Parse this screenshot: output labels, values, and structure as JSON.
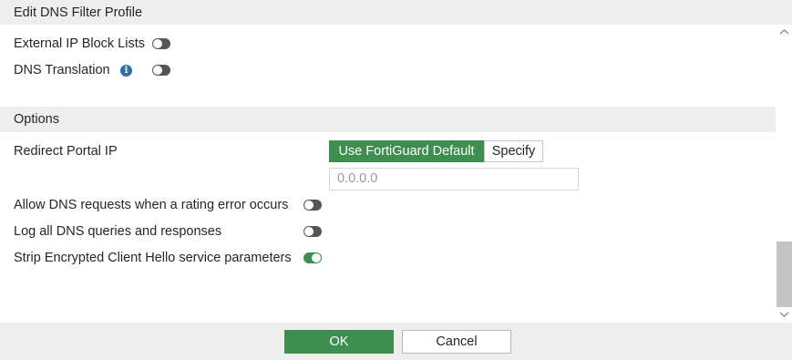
{
  "header": {
    "title": "Edit DNS Filter Profile"
  },
  "settings_top": {
    "external_ip_block_lists": {
      "label": "External IP Block Lists",
      "enabled": false
    },
    "dns_translation": {
      "label": "DNS Translation",
      "enabled": false,
      "info_glyph": "i"
    }
  },
  "options": {
    "section_title": "Options",
    "redirect_portal_ip": {
      "label": "Redirect Portal IP",
      "choice_default": "Use FortiGuard Default",
      "choice_specify": "Specify",
      "selected": "Use FortiGuard Default",
      "ip_placeholder": "0.0.0.0"
    },
    "allow_dns_rating_error": {
      "label": "Allow DNS requests when a rating error occurs",
      "enabled": false
    },
    "log_all_dns": {
      "label": "Log all DNS queries and responses",
      "enabled": false
    },
    "strip_ech": {
      "label": "Strip Encrypted Client Hello service parameters",
      "enabled": true
    }
  },
  "footer": {
    "ok_label": "OK",
    "cancel_label": "Cancel"
  },
  "icons": {
    "info": "info-icon",
    "scroll_up": "chevron-up-icon",
    "scroll_down": "chevron-down-icon"
  },
  "colors": {
    "accent_green": "#3e8e4f",
    "toggle_off": "#555555",
    "info_blue": "#2f6fa8",
    "panel_gray": "#eeeeee"
  }
}
